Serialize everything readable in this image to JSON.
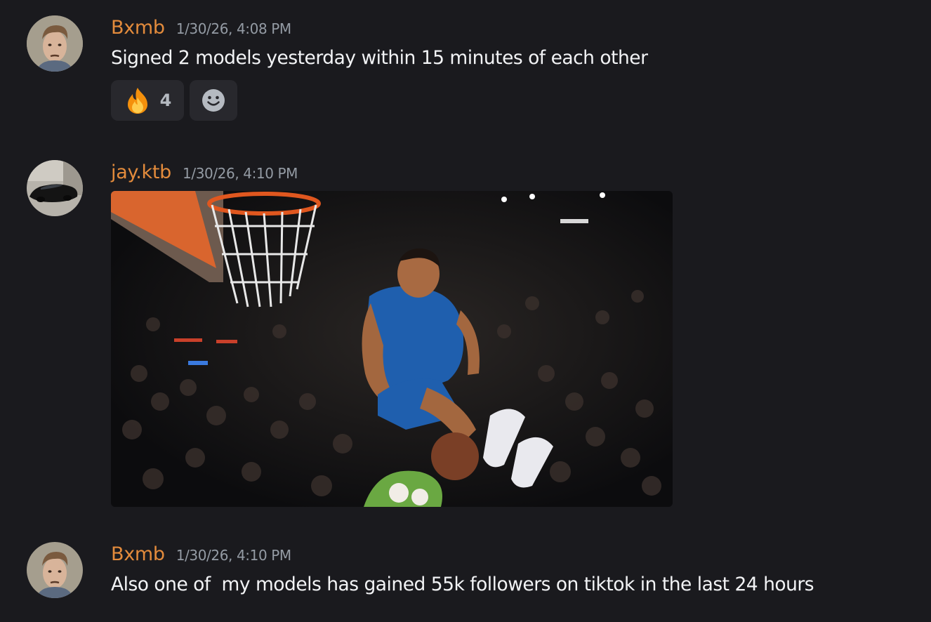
{
  "messages": [
    {
      "username": "Bxmb",
      "timestamp": "1/30/26, 4:08 PM",
      "content": "Signed 2 models yesterday within 15 minutes of each other",
      "avatar_icon": "user-avatar-portrait",
      "reactions": [
        {
          "emoji": "fire",
          "count": "4"
        }
      ],
      "add_reaction_icon": "smiley-icon"
    },
    {
      "username": "jay.ktb",
      "timestamp": "1/30/26, 4:10 PM",
      "avatar_icon": "car-avatar",
      "attachment": {
        "type": "gif",
        "subject": "slam-dunk"
      }
    },
    {
      "username": "Bxmb",
      "timestamp": "1/30/26, 4:10 PM",
      "content": "Also one of  my models has gained 55k followers on tiktok in the last 24 hours",
      "avatar_icon": "user-avatar-portrait"
    }
  ],
  "colors": {
    "background": "#1a1a1e",
    "username_bxmb": "#e38b3c",
    "username_jay": "#e38b3c",
    "timestamp": "#949ba4",
    "text": "#f2f3f5",
    "reaction_bg": "#28282d"
  }
}
